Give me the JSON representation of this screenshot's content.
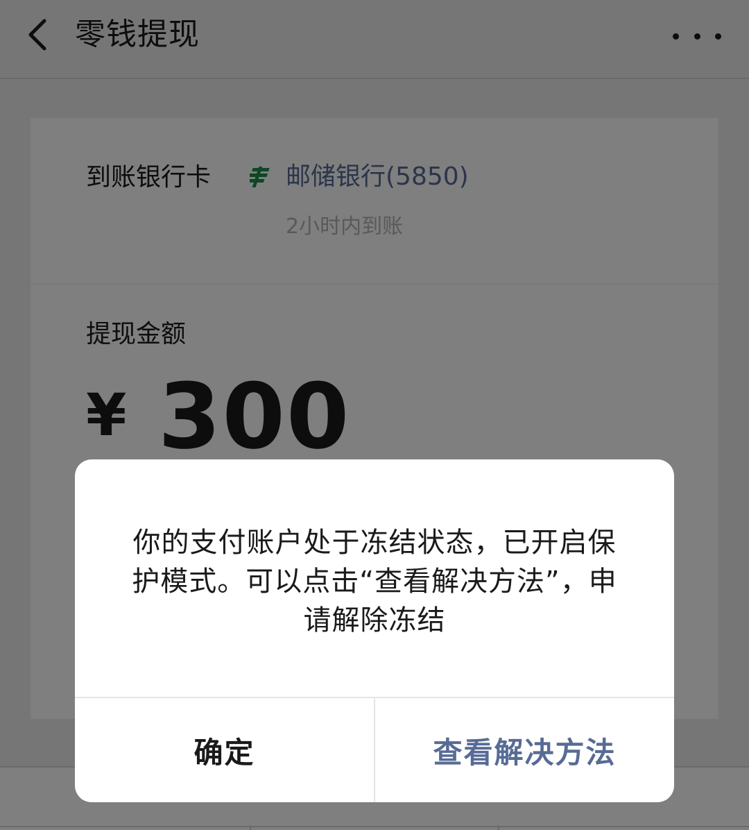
{
  "navbar": {
    "title": "零钱提现",
    "back_icon": "chevron-left-icon",
    "more_icon": "more-horizontal-icon"
  },
  "card": {
    "bank_label": "到账银行卡",
    "bank_icon": "postal-bank-logo-icon",
    "bank_name": "邮储银行(5850)",
    "arrival_time": "2小时内到账",
    "amount_label": "提现金额",
    "currency": "¥",
    "amount": "300"
  },
  "dialog": {
    "message": "你的支付账户处于冻结状态，已开启保护模式。可以点击“查看解决方法”，申请解除冻结",
    "confirm_label": "确定",
    "solution_label": "查看解决方法"
  },
  "colors": {
    "link": "#576b95",
    "bank_logo": "#1a8f4a",
    "text": "#1a1a1a",
    "muted": "#b2b2b2",
    "background": "#ededed"
  }
}
